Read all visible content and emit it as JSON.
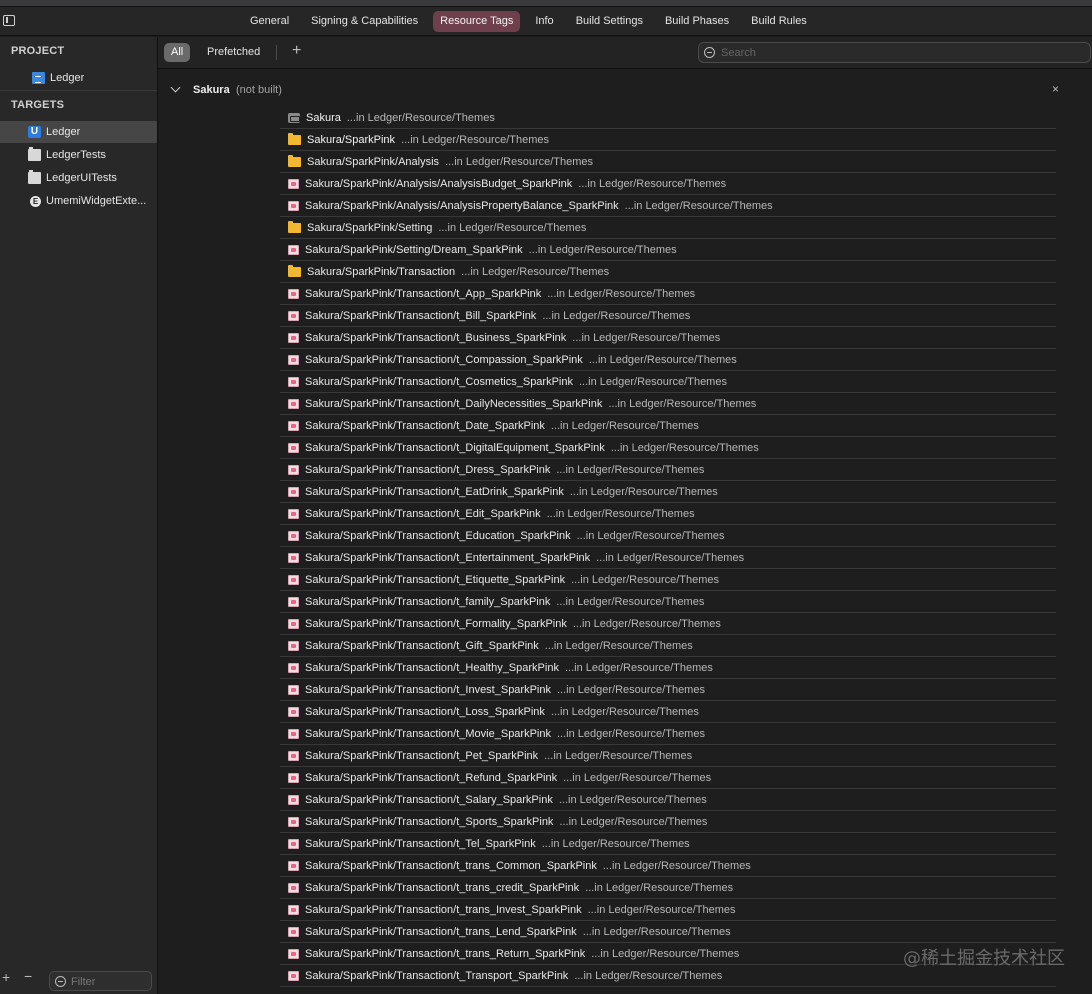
{
  "tabs": [
    "General",
    "Signing & Capabilities",
    "Resource Tags",
    "Info",
    "Build Settings",
    "Build Phases",
    "Build Rules"
  ],
  "sidebar": {
    "project_header": "PROJECT",
    "project_item": "Ledger",
    "targets_header": "TARGETS",
    "targets": [
      {
        "label": "Ledger",
        "icon": "app-icon"
      },
      {
        "label": "LedgerTests",
        "icon": "test-bundle-icon"
      },
      {
        "label": "LedgerUITests",
        "icon": "test-bundle-icon"
      },
      {
        "label": "UmemiWidgetExte...",
        "icon": "extension-icon"
      }
    ],
    "add_glyph": "+",
    "remove_glyph": "−",
    "filter_placeholder": "Filter"
  },
  "filterbar": {
    "all_label": "All",
    "prefetched_label": "Prefetched",
    "add_glyph": "+",
    "search_placeholder": "Search"
  },
  "group": {
    "title": "Sakura",
    "note": "(not built)",
    "close_glyph": "×"
  },
  "resources": [
    {
      "name": "Sakura",
      "loc": "...in Ledger/Resource/Themes",
      "icon": "catalog"
    },
    {
      "name": "Sakura/SparkPink",
      "loc": "...in Ledger/Resource/Themes",
      "icon": "folder"
    },
    {
      "name": "Sakura/SparkPink/Analysis",
      "loc": "...in Ledger/Resource/Themes",
      "icon": "folder"
    },
    {
      "name": "Sakura/SparkPink/Analysis/AnalysisBudget_SparkPink",
      "loc": "...in Ledger/Resource/Themes",
      "icon": "image"
    },
    {
      "name": "Sakura/SparkPink/Analysis/AnalysisPropertyBalance_SparkPink",
      "loc": "...in Ledger/Resource/Themes",
      "icon": "image"
    },
    {
      "name": "Sakura/SparkPink/Setting",
      "loc": "...in Ledger/Resource/Themes",
      "icon": "folder"
    },
    {
      "name": "Sakura/SparkPink/Setting/Dream_SparkPink",
      "loc": "...in Ledger/Resource/Themes",
      "icon": "image"
    },
    {
      "name": "Sakura/SparkPink/Transaction",
      "loc": "...in Ledger/Resource/Themes",
      "icon": "folder"
    },
    {
      "name": "Sakura/SparkPink/Transaction/t_App_SparkPink",
      "loc": "...in Ledger/Resource/Themes",
      "icon": "image"
    },
    {
      "name": "Sakura/SparkPink/Transaction/t_Bill_SparkPink",
      "loc": "...in Ledger/Resource/Themes",
      "icon": "image"
    },
    {
      "name": "Sakura/SparkPink/Transaction/t_Business_SparkPink",
      "loc": "...in Ledger/Resource/Themes",
      "icon": "image"
    },
    {
      "name": "Sakura/SparkPink/Transaction/t_Compassion_SparkPink",
      "loc": "...in Ledger/Resource/Themes",
      "icon": "image"
    },
    {
      "name": "Sakura/SparkPink/Transaction/t_Cosmetics_SparkPink",
      "loc": "...in Ledger/Resource/Themes",
      "icon": "image"
    },
    {
      "name": "Sakura/SparkPink/Transaction/t_DailyNecessities_SparkPink",
      "loc": "...in Ledger/Resource/Themes",
      "icon": "image"
    },
    {
      "name": "Sakura/SparkPink/Transaction/t_Date_SparkPink",
      "loc": "...in Ledger/Resource/Themes",
      "icon": "image"
    },
    {
      "name": "Sakura/SparkPink/Transaction/t_DigitalEquipment_SparkPink",
      "loc": "...in Ledger/Resource/Themes",
      "icon": "image"
    },
    {
      "name": "Sakura/SparkPink/Transaction/t_Dress_SparkPink",
      "loc": "...in Ledger/Resource/Themes",
      "icon": "image"
    },
    {
      "name": "Sakura/SparkPink/Transaction/t_EatDrink_SparkPink",
      "loc": "...in Ledger/Resource/Themes",
      "icon": "image"
    },
    {
      "name": "Sakura/SparkPink/Transaction/t_Edit_SparkPink",
      "loc": "...in Ledger/Resource/Themes",
      "icon": "image"
    },
    {
      "name": "Sakura/SparkPink/Transaction/t_Education_SparkPink",
      "loc": "...in Ledger/Resource/Themes",
      "icon": "image"
    },
    {
      "name": "Sakura/SparkPink/Transaction/t_Entertainment_SparkPink",
      "loc": "...in Ledger/Resource/Themes",
      "icon": "image"
    },
    {
      "name": "Sakura/SparkPink/Transaction/t_Etiquette_SparkPink",
      "loc": "...in Ledger/Resource/Themes",
      "icon": "image"
    },
    {
      "name": "Sakura/SparkPink/Transaction/t_family_SparkPink",
      "loc": "...in Ledger/Resource/Themes",
      "icon": "image"
    },
    {
      "name": "Sakura/SparkPink/Transaction/t_Formality_SparkPink",
      "loc": "...in Ledger/Resource/Themes",
      "icon": "image"
    },
    {
      "name": "Sakura/SparkPink/Transaction/t_Gift_SparkPink",
      "loc": "...in Ledger/Resource/Themes",
      "icon": "image"
    },
    {
      "name": "Sakura/SparkPink/Transaction/t_Healthy_SparkPink",
      "loc": "...in Ledger/Resource/Themes",
      "icon": "image"
    },
    {
      "name": "Sakura/SparkPink/Transaction/t_Invest_SparkPink",
      "loc": "...in Ledger/Resource/Themes",
      "icon": "image"
    },
    {
      "name": "Sakura/SparkPink/Transaction/t_Loss_SparkPink",
      "loc": "...in Ledger/Resource/Themes",
      "icon": "image"
    },
    {
      "name": "Sakura/SparkPink/Transaction/t_Movie_SparkPink",
      "loc": "...in Ledger/Resource/Themes",
      "icon": "image"
    },
    {
      "name": "Sakura/SparkPink/Transaction/t_Pet_SparkPink",
      "loc": "...in Ledger/Resource/Themes",
      "icon": "image"
    },
    {
      "name": "Sakura/SparkPink/Transaction/t_Refund_SparkPink",
      "loc": "...in Ledger/Resource/Themes",
      "icon": "image"
    },
    {
      "name": "Sakura/SparkPink/Transaction/t_Salary_SparkPink",
      "loc": "...in Ledger/Resource/Themes",
      "icon": "image"
    },
    {
      "name": "Sakura/SparkPink/Transaction/t_Sports_SparkPink",
      "loc": "...in Ledger/Resource/Themes",
      "icon": "image"
    },
    {
      "name": "Sakura/SparkPink/Transaction/t_Tel_SparkPink",
      "loc": "...in Ledger/Resource/Themes",
      "icon": "image"
    },
    {
      "name": "Sakura/SparkPink/Transaction/t_trans_Common_SparkPink",
      "loc": "...in Ledger/Resource/Themes",
      "icon": "image"
    },
    {
      "name": "Sakura/SparkPink/Transaction/t_trans_credit_SparkPink",
      "loc": "...in Ledger/Resource/Themes",
      "icon": "image"
    },
    {
      "name": "Sakura/SparkPink/Transaction/t_trans_Invest_SparkPink",
      "loc": "...in Ledger/Resource/Themes",
      "icon": "image"
    },
    {
      "name": "Sakura/SparkPink/Transaction/t_trans_Lend_SparkPink",
      "loc": "...in Ledger/Resource/Themes",
      "icon": "image"
    },
    {
      "name": "Sakura/SparkPink/Transaction/t_trans_Return_SparkPink",
      "loc": "...in Ledger/Resource/Themes",
      "icon": "image"
    },
    {
      "name": "Sakura/SparkPink/Transaction/t_Transport_SparkPink",
      "loc": "...in Ledger/Resource/Themes",
      "icon": "image"
    }
  ],
  "watermark": "@稀土掘金技术社区",
  "colors": {
    "active_tab": "#6e3f4c",
    "folder": "#f2b731",
    "selection": "#464646"
  }
}
